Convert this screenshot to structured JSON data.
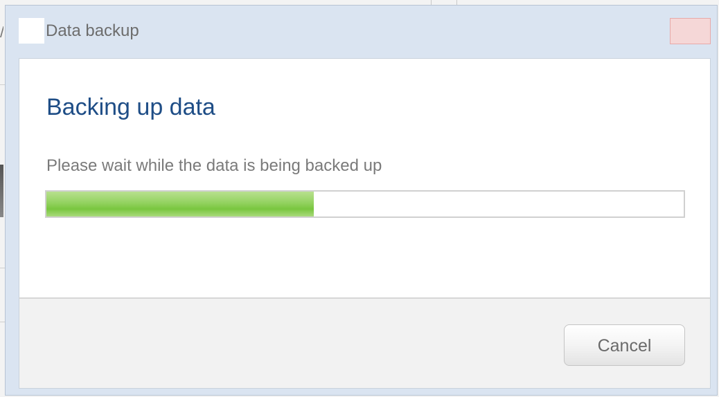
{
  "dialog": {
    "title": "Data backup",
    "heading": "Backing up data",
    "message": "Please wait while the data is being backed up",
    "progress_fraction": 0.42,
    "cancel_label": "Cancel"
  },
  "colors": {
    "titlebar_background": "#dae4f1",
    "heading_text": "#1e4d86",
    "progress_fill": "#93d260",
    "close_button": "#f5d7d7"
  },
  "icons": {
    "app": "app-icon",
    "close": "close-icon"
  }
}
